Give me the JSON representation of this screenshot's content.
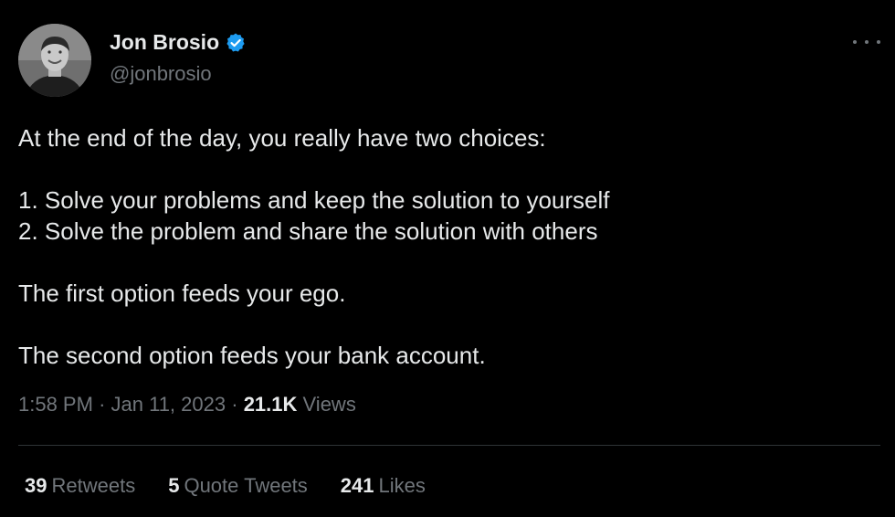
{
  "author": {
    "display_name": "Jon Brosio",
    "handle": "@jonbrosio",
    "verified": true,
    "verified_color": "#1d9bf0"
  },
  "tweet": {
    "lines": [
      "At the end of the day, you really have two choices:",
      "",
      "1. Solve your problems and keep the solution to yourself",
      "2. Solve the problem and share the solution with others",
      "",
      "The first option feeds your ego.",
      "",
      "The second option feeds your bank account."
    ],
    "time": "1:58 PM",
    "separator": "·",
    "date": "Jan 11, 2023",
    "views_count": "21.1K",
    "views_label": "Views"
  },
  "stats": {
    "retweets": {
      "count": "39",
      "label": "Retweets"
    },
    "quotes": {
      "count": "5",
      "label": "Quote Tweets"
    },
    "likes": {
      "count": "241",
      "label": "Likes"
    }
  },
  "icons": {
    "more": "more-icon",
    "verified": "verified-badge-icon"
  },
  "colors": {
    "background": "#000000",
    "text_primary": "#e7e9ea",
    "text_secondary": "#71767b",
    "divider": "#2f3336"
  }
}
